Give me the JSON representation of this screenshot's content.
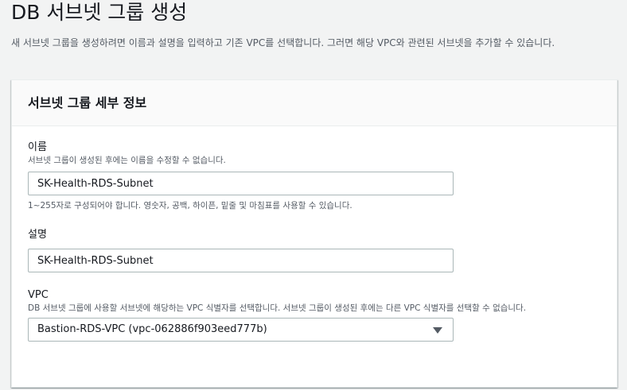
{
  "page": {
    "title": "DB 서브넷 그룹 생성",
    "description": "새 서브넷 그룹을 생성하려면 이름과 설명을 입력하고 기존 VPC를 선택합니다. 그러면 해당 VPC와 관련된 서브넷을 추가할 수 있습니다."
  },
  "panel": {
    "title": "서브넷 그룹 세부 정보",
    "name_field": {
      "label": "이름",
      "description": "서브넷 그룹이 생성된 후에는 이름을 수정할 수 없습니다.",
      "value": "SK-Health-RDS-Subnet",
      "constraint": "1~255자로 구성되어야 합니다. 영숫자, 공백, 하이픈, 밑줄 및 마침표를 사용할 수 있습니다."
    },
    "description_field": {
      "label": "설명",
      "value": "SK-Health-RDS-Subnet"
    },
    "vpc_field": {
      "label": "VPC",
      "description": "DB 서브넷 그룹에 사용할 서브넷에 해당하는 VPC 식별자를 선택합니다. 서브넷 그룹이 생성된 후에는 다른 VPC 식별자를 선택할 수 없습니다.",
      "selected": "Bastion-RDS-VPC (vpc-062886f903eed777b)",
      "icon": "caret-down-icon"
    }
  }
}
